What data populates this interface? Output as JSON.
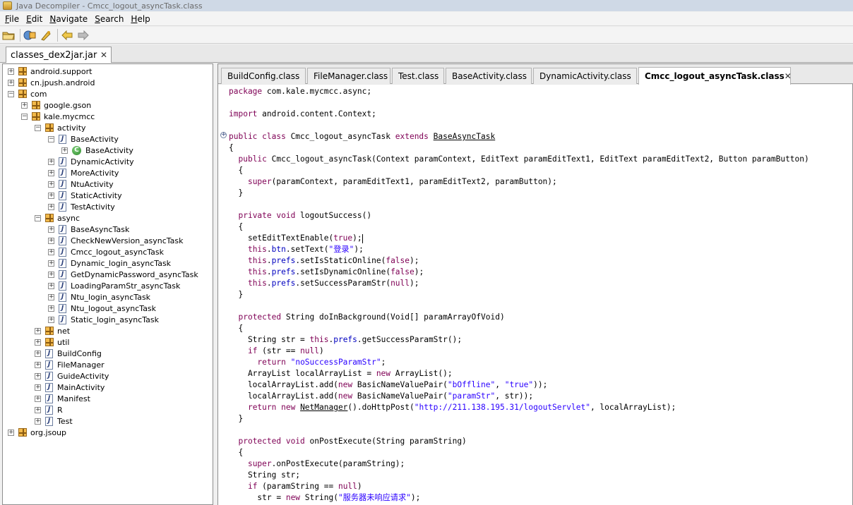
{
  "window": {
    "title": "Java Decompiler - Cmcc_logout_asyncTask.class"
  },
  "menu": [
    "File",
    "Edit",
    "Navigate",
    "Search",
    "Help"
  ],
  "toolbar": {
    "icons": [
      "open-folder-icon",
      "open-type-icon",
      "search-icon",
      "back-arrow-icon",
      "forward-arrow-icon"
    ]
  },
  "file_tab": {
    "label": "classes_dex2jar.jar"
  },
  "tree": [
    {
      "label": "android.support",
      "icon": "package",
      "depth": 0,
      "expander": "+"
    },
    {
      "label": "cn.jpush.android",
      "icon": "package",
      "depth": 0,
      "expander": "+"
    },
    {
      "label": "com",
      "icon": "package",
      "depth": 0,
      "expander": "-"
    },
    {
      "label": "google.gson",
      "icon": "package",
      "depth": 1,
      "expander": "+"
    },
    {
      "label": "kale.mycmcc",
      "icon": "package",
      "depth": 1,
      "expander": "-"
    },
    {
      "label": "activity",
      "icon": "package",
      "depth": 2,
      "expander": "-"
    },
    {
      "label": "BaseActivity",
      "icon": "file",
      "depth": 3,
      "expander": "-"
    },
    {
      "label": "BaseActivity",
      "icon": "class",
      "depth": 4,
      "expander": "+"
    },
    {
      "label": "DynamicActivity",
      "icon": "file",
      "depth": 3,
      "expander": "+"
    },
    {
      "label": "MoreActivity",
      "icon": "file",
      "depth": 3,
      "expander": "+"
    },
    {
      "label": "NtuActivity",
      "icon": "file",
      "depth": 3,
      "expander": "+"
    },
    {
      "label": "StaticActivity",
      "icon": "file",
      "depth": 3,
      "expander": "+"
    },
    {
      "label": "TestActivity",
      "icon": "file",
      "depth": 3,
      "expander": "+"
    },
    {
      "label": "async",
      "icon": "package",
      "depth": 2,
      "expander": "-"
    },
    {
      "label": "BaseAsyncTask",
      "icon": "file",
      "depth": 3,
      "expander": "+"
    },
    {
      "label": "CheckNewVersion_asyncTask",
      "icon": "file",
      "depth": 3,
      "expander": "+"
    },
    {
      "label": "Cmcc_logout_asyncTask",
      "icon": "file",
      "depth": 3,
      "expander": "+"
    },
    {
      "label": "Dynamic_login_asyncTask",
      "icon": "file",
      "depth": 3,
      "expander": "+"
    },
    {
      "label": "GetDynamicPassword_asyncTask",
      "icon": "file",
      "depth": 3,
      "expander": "+"
    },
    {
      "label": "LoadingParamStr_asyncTask",
      "icon": "file",
      "depth": 3,
      "expander": "+"
    },
    {
      "label": "Ntu_login_asyncTask",
      "icon": "file",
      "depth": 3,
      "expander": "+"
    },
    {
      "label": "Ntu_logout_asyncTask",
      "icon": "file",
      "depth": 3,
      "expander": "+"
    },
    {
      "label": "Static_login_asyncTask",
      "icon": "file",
      "depth": 3,
      "expander": "+"
    },
    {
      "label": "net",
      "icon": "package",
      "depth": 2,
      "expander": "+"
    },
    {
      "label": "util",
      "icon": "package",
      "depth": 2,
      "expander": "+"
    },
    {
      "label": "BuildConfig",
      "icon": "file",
      "depth": 2,
      "expander": "+"
    },
    {
      "label": "FileManager",
      "icon": "file",
      "depth": 2,
      "expander": "+"
    },
    {
      "label": "GuideActivity",
      "icon": "file",
      "depth": 2,
      "expander": "+"
    },
    {
      "label": "MainActivity",
      "icon": "file",
      "depth": 2,
      "expander": "+"
    },
    {
      "label": "Manifest",
      "icon": "file",
      "depth": 2,
      "expander": "+"
    },
    {
      "label": "R",
      "icon": "file",
      "depth": 2,
      "expander": "+"
    },
    {
      "label": "Test",
      "icon": "file",
      "depth": 2,
      "expander": "+"
    },
    {
      "label": "org.jsoup",
      "icon": "package",
      "depth": 0,
      "expander": "+"
    }
  ],
  "class_tabs": [
    {
      "label": "BuildConfig.class",
      "active": false
    },
    {
      "label": "FileManager.class",
      "active": false
    },
    {
      "label": "Test.class",
      "active": false
    },
    {
      "label": "BaseActivity.class",
      "active": false
    },
    {
      "label": "DynamicActivity.class",
      "active": false
    },
    {
      "label": "Cmcc_logout_asyncTask.class",
      "active": true
    }
  ],
  "code": [
    "<span class=\"kw\">package</span> com.kale.mycmcc.async;",
    "",
    "<span class=\"kw\">import</span> android.content.Context;",
    "",
    "<span class=\"kw\">public class</span> Cmcc_logout_asyncTask <span class=\"kw\">extends</span> <span class=\"ul\">BaseAsyncTask</span>",
    "{",
    "  <span class=\"kw\">public</span> Cmcc_logout_asyncTask(Context paramContext, EditText paramEditText1, EditText paramEditText2, Button paramButton)",
    "  {",
    "    <span class=\"kw\">super</span>(paramContext, paramEditText1, paramEditText2, paramButton);",
    "  }",
    "",
    "  <span class=\"kw\">private void</span> logoutSuccess()",
    "  {",
    "    setEditTextEnable(<span class=\"kw\">true</span>);<span class=\"caret\"></span>",
    "    <span class=\"kw\">this</span>.<span class=\"fld\">btn</span>.setText(<span class=\"str\">\"登录\"</span>);",
    "    <span class=\"kw\">this</span>.<span class=\"fld\">prefs</span>.setIsStaticOnline(<span class=\"kw\">false</span>);",
    "    <span class=\"kw\">this</span>.<span class=\"fld\">prefs</span>.setIsDynamicOnline(<span class=\"kw\">false</span>);",
    "    <span class=\"kw\">this</span>.<span class=\"fld\">prefs</span>.setSuccessParamStr(<span class=\"kw\">null</span>);",
    "  }",
    "",
    "  <span class=\"kw\">protected</span> String doInBackground(Void[] paramArrayOfVoid)",
    "  {",
    "    String str = <span class=\"kw\">this</span>.<span class=\"fld\">prefs</span>.getSuccessParamStr();",
    "    <span class=\"kw\">if</span> (str == <span class=\"kw\">null</span>)",
    "      <span class=\"kw\">return</span> <span class=\"str\">\"noSuccessParamStr\"</span>;",
    "    ArrayList localArrayList = <span class=\"kw\">new</span> ArrayList();",
    "    localArrayList.add(<span class=\"kw\">new</span> BasicNameValuePair(<span class=\"str\">\"bOffline\"</span>, <span class=\"str\">\"true\"</span>));",
    "    localArrayList.add(<span class=\"kw\">new</span> BasicNameValuePair(<span class=\"str\">\"paramStr\"</span>, str));",
    "    <span class=\"kw\">return new</span> <span class=\"ul\">NetManager</span>().doHttpPost(<span class=\"str\">\"http://211.138.195.31/logoutServlet\"</span>, localArrayList);",
    "  }",
    "",
    "  <span class=\"kw\">protected void</span> onPostExecute(String paramString)",
    "  {",
    "    <span class=\"kw\">super</span>.onPostExecute(paramString);",
    "    String str;",
    "    <span class=\"kw\">if</span> (paramString == <span class=\"kw\">null</span>)",
    "      str = <span class=\"kw\">new</span> String(<span class=\"str\">\"服务器未响应请求\"</span>);"
  ]
}
